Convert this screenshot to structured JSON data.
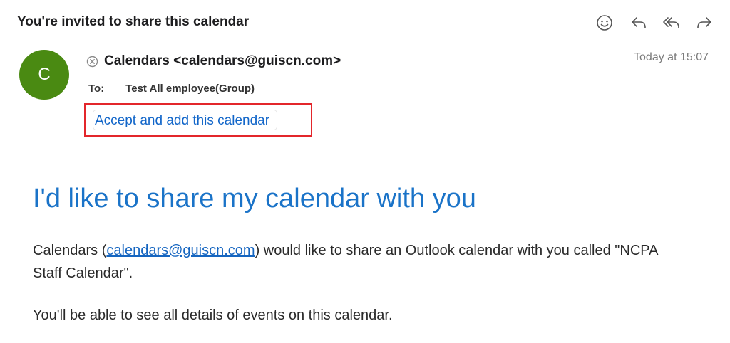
{
  "subject": "You're invited to share this calendar",
  "toolbar": {
    "icons": [
      "smiley-icon",
      "reply-icon",
      "reply-all-icon",
      "forward-icon"
    ]
  },
  "sender": {
    "avatar_initial": "C",
    "avatar_color": "#4a8a12",
    "display": "Calendars <calendars@guiscn.com>"
  },
  "timestamp": "Today at 15:07",
  "recipients": {
    "label": "To:",
    "value": "Test All employee(Group)"
  },
  "accept_button": "Accept and add this calendar",
  "message": {
    "headline": "I'd like to share my calendar with you",
    "para1_prefix": "Calendars (",
    "para1_link": "calendars@guiscn.com",
    "para1_suffix": ") would like to share an Outlook calendar with you called \"NCPA Staff Calendar\".",
    "para2": "You'll be able to see all details of events on this calendar."
  },
  "colors": {
    "accent": "#1a73c8",
    "highlight_border": "#e3262b"
  }
}
